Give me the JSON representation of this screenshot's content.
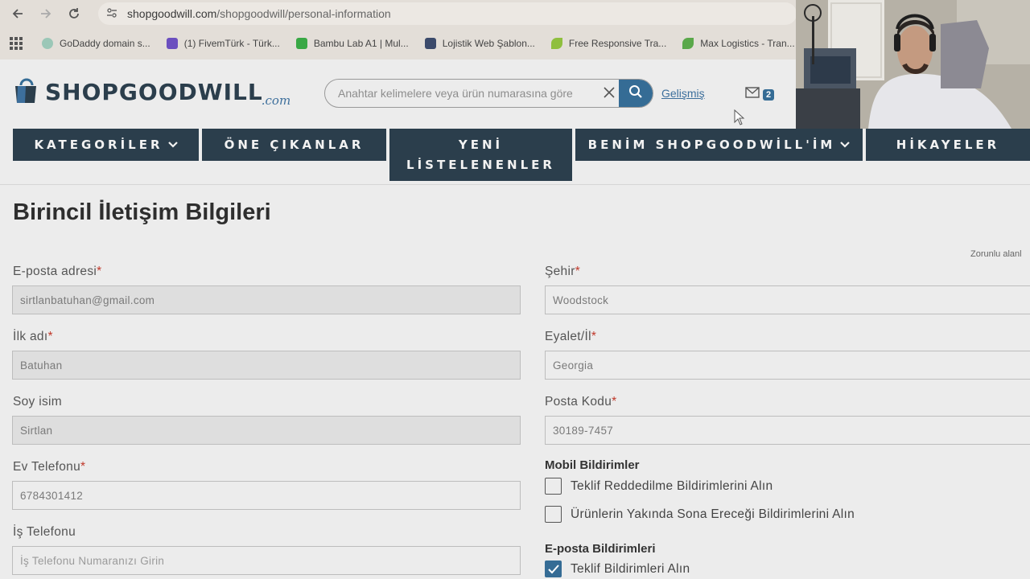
{
  "browser": {
    "url_host": "shopgoodwill.com",
    "url_path": "/shopgoodwill/personal-information",
    "bookmarks": [
      {
        "label": "GoDaddy domain s...",
        "color": "#9bc7b7"
      },
      {
        "label": "(1) FivemTürk - Türk...",
        "color": "#6b4fbf"
      },
      {
        "label": "Bambu Lab A1 | Mul...",
        "color": "#39a845"
      },
      {
        "label": "Lojistik Web Şablon...",
        "color": "#3b4a6b"
      },
      {
        "label": "Free Responsive Tra...",
        "color": "#8fbf3e"
      },
      {
        "label": "Max Logistics - Tran...",
        "color": "#5aa84a"
      }
    ]
  },
  "header": {
    "logo_main": "SHOPGOODWILL",
    "logo_suffix": ".com",
    "search_placeholder": "Anahtar kelimelere veya ürün numarasına göre",
    "advanced_label": "Gelişmiş",
    "mail_count": "2"
  },
  "nav": {
    "categories": "KATEGORİLER",
    "featured": "ÖNE ÇIKANLAR",
    "new_listings_line1": "YENİ",
    "new_listings_line2": "LİSTELENENLER",
    "my_account": "BENİM SHOPGOODWİLL'İM",
    "stories": "HİKAYELER"
  },
  "page": {
    "title": "Birincil İletişim Bilgileri",
    "required_note": "Zorunlu alanl"
  },
  "form": {
    "email": {
      "label": "E-posta adresi",
      "value": "sirtlanbatuhan@gmail.com"
    },
    "first_name": {
      "label": "İlk adı",
      "value": "Batuhan"
    },
    "last_name": {
      "label": "Soy isim",
      "value": "Sirtlan"
    },
    "home_phone": {
      "label": "Ev Telefonu",
      "value": "6784301412"
    },
    "work_phone": {
      "label": "İş Telefonu",
      "placeholder": "İş Telefonu Numaranızı Girin"
    },
    "city": {
      "label": "Şehir",
      "value": "Woodstock"
    },
    "state": {
      "label": "Eyalet/İl",
      "value": "Georgia"
    },
    "zip": {
      "label": "Posta Kodu",
      "value": "30189-7457"
    },
    "required_mark": "*"
  },
  "notifications": {
    "mobile_title": "Mobil Bildirimler",
    "mobile_offer_declined": "Teklif Reddedilme Bildirimlerini Alın",
    "mobile_ending_soon": "Ürünlerin Yakında Sona Ereceği Bildirimlerini Alın",
    "email_title": "E-posta Bildirimleri",
    "email_offer": "Teklif Bildirimleri Alın"
  }
}
